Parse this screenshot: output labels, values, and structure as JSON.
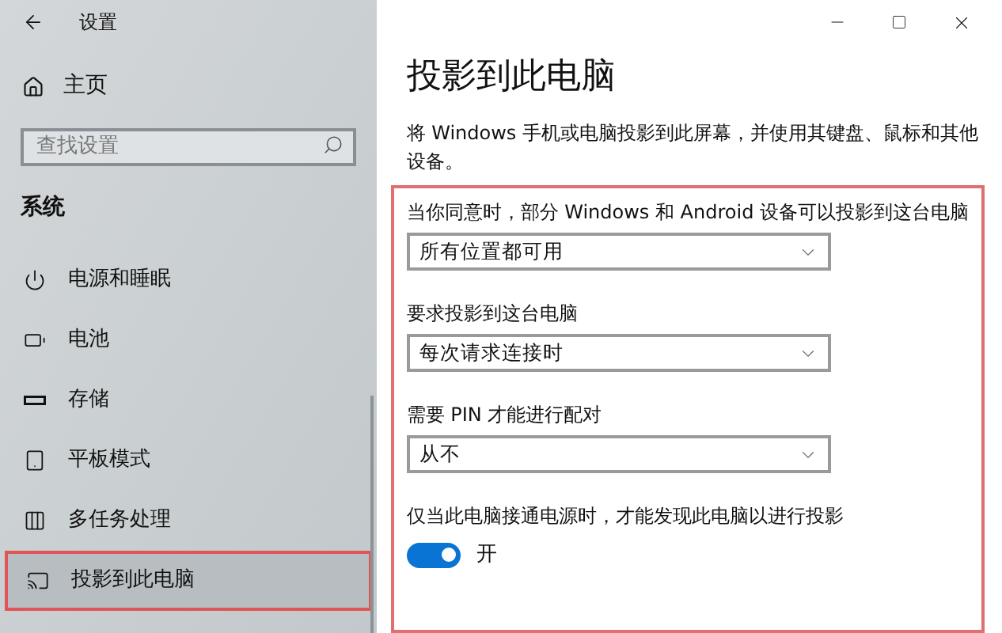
{
  "window": {
    "title": "设置"
  },
  "sidebar": {
    "home": "主页",
    "search": {
      "placeholder": "查找设置"
    },
    "section": "系统",
    "items": [
      {
        "label": "电源和睡眠",
        "selected": false
      },
      {
        "label": "电池",
        "selected": false
      },
      {
        "label": "存储",
        "selected": false
      },
      {
        "label": "平板模式",
        "selected": false
      },
      {
        "label": "多任务处理",
        "selected": false
      },
      {
        "label": "投影到此电脑",
        "selected": true
      }
    ]
  },
  "page": {
    "title": "投影到此电脑",
    "description": "将 Windows 手机或电脑投影到此屏幕，并使用其键盘、鼠标和其他设备。",
    "settings": [
      {
        "kind": "dropdown",
        "label": "当你同意时，部分 Windows 和 Android 设备可以投影到这台电脑",
        "value": "所有位置都可用"
      },
      {
        "kind": "dropdown",
        "label": "要求投影到这台电脑",
        "value": "每次请求连接时"
      },
      {
        "kind": "dropdown",
        "label": "需要 PIN 才能进行配对",
        "value": "从不"
      },
      {
        "kind": "toggle",
        "label": "仅当此电脑接通电源时，才能发现此电脑以进行投影",
        "on": true,
        "state": "开"
      }
    ]
  }
}
